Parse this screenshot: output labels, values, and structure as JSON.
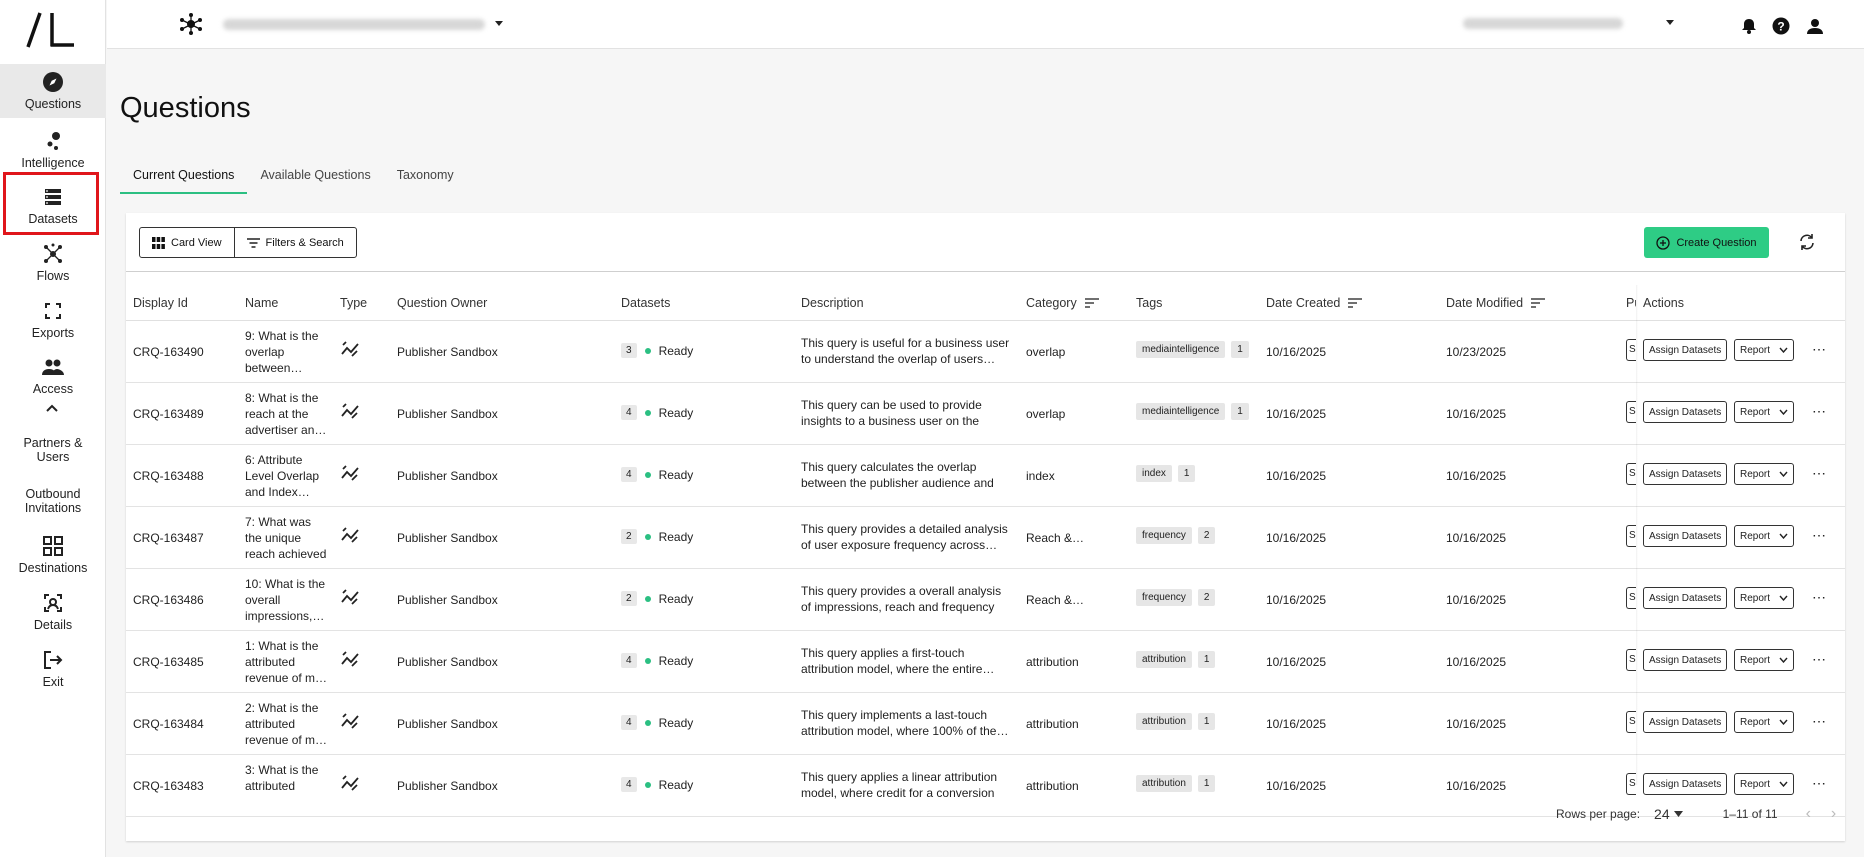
{
  "sidebar": {
    "items": [
      {
        "label": "Questions",
        "icon": "compass-icon"
      },
      {
        "label": "Intelligence",
        "icon": "intelligence-icon"
      },
      {
        "label": "Datasets",
        "icon": "datasets-icon"
      },
      {
        "label": "Flows",
        "icon": "flows-icon"
      },
      {
        "label": "Exports",
        "icon": "exports-icon"
      },
      {
        "label": "Access",
        "icon": "access-icon"
      },
      {
        "label": "Partners & Users"
      },
      {
        "label": "Outbound Invitations"
      },
      {
        "label": "Destinations",
        "icon": "destinations-icon"
      },
      {
        "label": "Details",
        "icon": "details-icon"
      },
      {
        "label": "Exit",
        "icon": "exit-icon"
      }
    ]
  },
  "page": {
    "title": "Questions",
    "tabs": [
      "Current Questions",
      "Available Questions",
      "Taxonomy"
    ]
  },
  "toolbar": {
    "card_view": "Card View",
    "filters": "Filters & Search",
    "create": "Create Question"
  },
  "table": {
    "headers": {
      "display_id": "Display Id",
      "name": "Name",
      "type": "Type",
      "owner": "Question Owner",
      "datasets": "Datasets",
      "description": "Description",
      "category": "Category",
      "tags": "Tags",
      "created": "Date Created",
      "modified": "Date Modified",
      "partial": "Pu",
      "actions": "Actions"
    },
    "assign_label": "Assign Datasets",
    "report_label": "Report",
    "pill_label": "S",
    "rows": [
      {
        "id": "CRQ-163490",
        "name": "9: What is the overlap between…",
        "owner": "Publisher Sandbox",
        "ds_count": "3",
        "status": "Ready",
        "desc": "This query is useful for a business user to understand the overlap of users…",
        "category": "overlap",
        "tag": "mediaintelligence",
        "tag_count": "1",
        "created": "10/16/2025",
        "modified": "10/23/2025"
      },
      {
        "id": "CRQ-163489",
        "name": "8: What is the reach at the advertiser an…",
        "owner": "Publisher Sandbox",
        "ds_count": "4",
        "status": "Ready",
        "desc": "This query can be used to provide insights to a business user on the reac…",
        "category": "overlap",
        "tag": "mediaintelligence",
        "tag_count": "1",
        "created": "10/16/2025",
        "modified": "10/16/2025"
      },
      {
        "id": "CRQ-163488",
        "name": "6: Attribute Level Overlap and Index…",
        "owner": "Publisher Sandbox",
        "ds_count": "4",
        "status": "Ready",
        "desc": "This query calculates the overlap between the publisher audience and t…",
        "category": "index",
        "tag": "index",
        "tag_count": "1",
        "created": "10/16/2025",
        "modified": "10/16/2025"
      },
      {
        "id": "CRQ-163487",
        "name": "7: What was the unique reach achieved by t…",
        "owner": "Publisher Sandbox",
        "ds_count": "2",
        "status": "Ready",
        "desc": "This query provides a detailed analysis of user exposure frequency across…",
        "category": "Reach &…",
        "tag": "frequency",
        "tag_count": "2",
        "created": "10/16/2025",
        "modified": "10/16/2025"
      },
      {
        "id": "CRQ-163486",
        "name": "10: What is the overall impressions,…",
        "owner": "Publisher Sandbox",
        "ds_count": "2",
        "status": "Ready",
        "desc": "This query provides a overall analysis of impressions, reach and frequency for…",
        "category": "Reach &…",
        "tag": "frequency",
        "tag_count": "2",
        "created": "10/16/2025",
        "modified": "10/16/2025"
      },
      {
        "id": "CRQ-163485",
        "name": "1: What is the attributed revenue of m…",
        "owner": "Publisher Sandbox",
        "ds_count": "4",
        "status": "Ready",
        "desc": "This query applies a first-touch attribution model, where the entire…",
        "category": "attribution",
        "tag": "attribution",
        "tag_count": "1",
        "created": "10/16/2025",
        "modified": "10/16/2025"
      },
      {
        "id": "CRQ-163484",
        "name": "2: What is the attributed revenue of m…",
        "owner": "Publisher Sandbox",
        "ds_count": "4",
        "status": "Ready",
        "desc": "This query implements a last-touch attribution model, where 100% of the…",
        "category": "attribution",
        "tag": "attribution",
        "tag_count": "1",
        "created": "10/16/2025",
        "modified": "10/16/2025"
      },
      {
        "id": "CRQ-163483",
        "name": "3: What is the attributed",
        "owner": "Publisher Sandbox",
        "ds_count": "4",
        "status": "Ready",
        "desc": "This query applies a linear attribution model, where credit for a conversion i…",
        "category": "attribution",
        "tag": "attribution",
        "tag_count": "1",
        "created": "10/16/2025",
        "modified": "10/16/2025"
      }
    ]
  },
  "pagination": {
    "rows_label": "Rows per page:",
    "rows_value": "24",
    "range": "1–11 of 11"
  }
}
